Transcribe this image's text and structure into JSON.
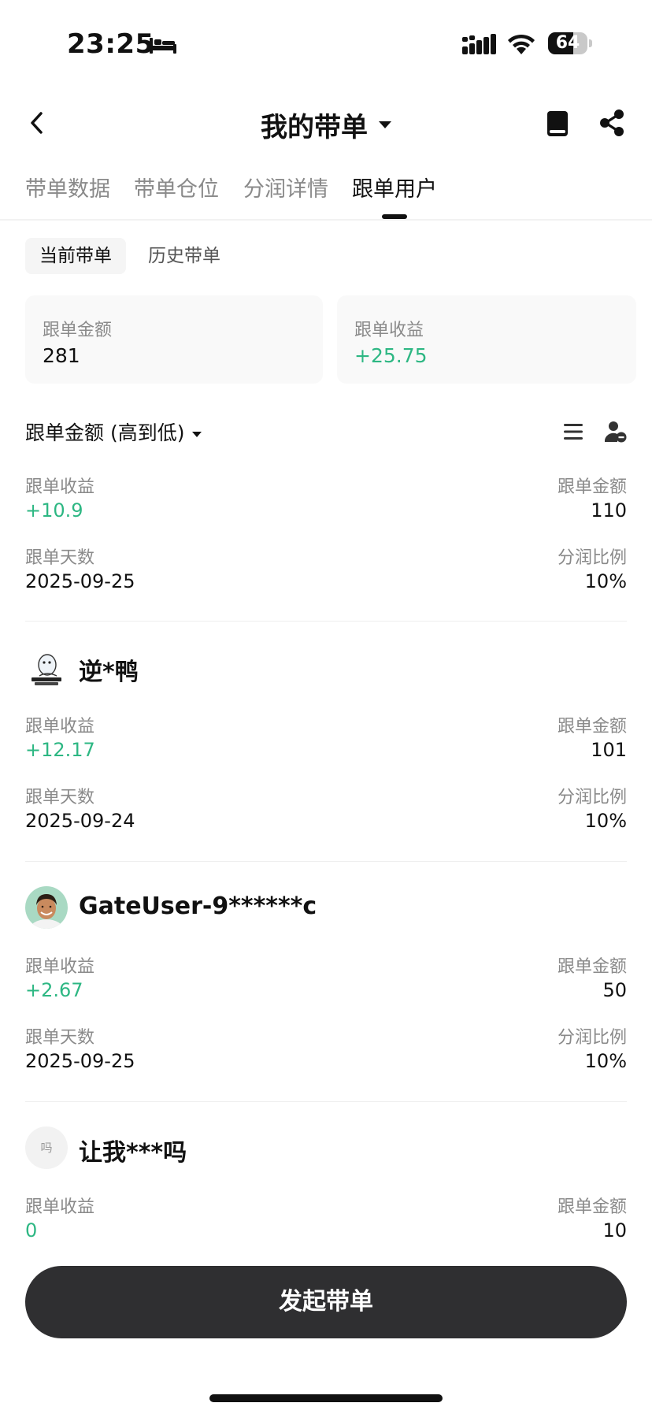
{
  "status_bar": {
    "time": "23:25",
    "battery": "64",
    "battery_level": 0.64
  },
  "nav": {
    "title": "我的带单"
  },
  "tabs": [
    {
      "label": "带单数据",
      "active": false
    },
    {
      "label": "带单仓位",
      "active": false
    },
    {
      "label": "分润详情",
      "active": false
    },
    {
      "label": "跟单用户",
      "active": true
    }
  ],
  "subtabs": [
    {
      "label": "当前带单",
      "active": true
    },
    {
      "label": "历史带单",
      "active": false
    }
  ],
  "summary": {
    "amount_label": "跟单金额",
    "amount_value": "281",
    "profit_label": "跟单收益",
    "profit_value": "+25.75"
  },
  "sort": {
    "label": "跟单金额 (高到低)"
  },
  "field_labels": {
    "profit": "跟单收益",
    "amount": "跟单金额",
    "days": "跟单天数",
    "ratio": "分润比例"
  },
  "users": [
    {
      "name": "",
      "profit": "+10.9",
      "amount": "110",
      "days": "2025-09-25",
      "ratio": "10%"
    },
    {
      "name": "逆*鸭",
      "avatar_text": "",
      "profit": "+12.17",
      "amount": "101",
      "days": "2025-09-24",
      "ratio": "10%"
    },
    {
      "name": "GateUser-9******c",
      "profit": "+2.67",
      "amount": "50",
      "days": "2025-09-25",
      "ratio": "10%"
    },
    {
      "name": "让我***吗",
      "avatar_text": "吗",
      "profit": "0",
      "amount": "10"
    }
  ],
  "cta": {
    "label": "发起带单"
  },
  "colors": {
    "positive": "#2db783",
    "cta_bg": "#2f2f31",
    "muted": "#8a8a8a"
  }
}
